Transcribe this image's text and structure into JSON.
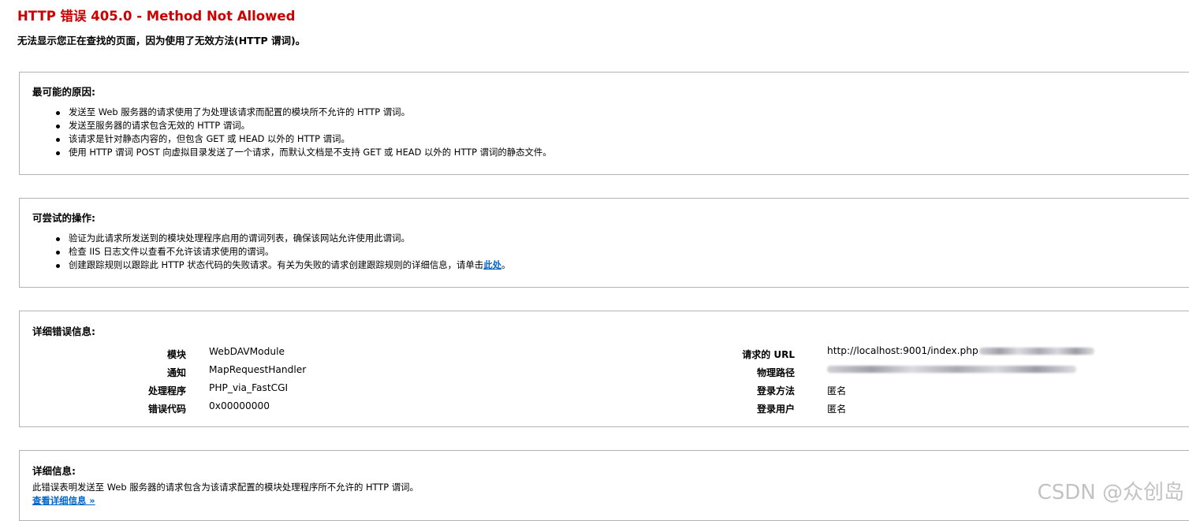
{
  "header": {
    "title": "HTTP 错误 405.0 - Method Not Allowed",
    "subtitle": "无法显示您正在查找的页面，因为使用了无效方法(HTTP 谓词)。"
  },
  "causes": {
    "title": "最可能的原因:",
    "items": [
      "发送至 Web 服务器的请求使用了为处理该请求而配置的模块所不允许的 HTTP 谓词。",
      "发送至服务器的请求包含无效的 HTTP 谓词。",
      "该请求是针对静态内容的，但包含 GET 或 HEAD 以外的 HTTP 谓词。",
      "使用 HTTP 谓词 POST 向虚拟目录发送了一个请求，而默认文档是不支持 GET 或 HEAD 以外的 HTTP 谓词的静态文件。"
    ]
  },
  "actions": {
    "title": "可尝试的操作:",
    "items": [
      "验证为此请求所发送到的模块处理程序启用的谓词列表，确保该网站允许使用此谓词。",
      "检查 IIS 日志文件以查看不允许该请求使用的谓词。"
    ],
    "last_item_prefix": "创建跟踪规则以跟踪此 HTTP 状态代码的失败请求。有关为失败的请求创建跟踪规则的详细信息，请单击",
    "last_item_link": "此处",
    "last_item_suffix": "。"
  },
  "error_info": {
    "title": "详细错误信息:",
    "left": [
      {
        "label": "模块",
        "value": "WebDAVModule"
      },
      {
        "label": "通知",
        "value": "MapRequestHandler"
      },
      {
        "label": "处理程序",
        "value": "PHP_via_FastCGI"
      },
      {
        "label": "错误代码",
        "value": "0x00000000"
      }
    ],
    "right": [
      {
        "label": "请求的 URL",
        "value": "http://localhost:9001/index.php"
      },
      {
        "label": "物理路径",
        "value": ""
      },
      {
        "label": "登录方法",
        "value": "匿名"
      },
      {
        "label": "登录用户",
        "value": "匿名"
      }
    ]
  },
  "details": {
    "title": "详细信息:",
    "text": "此错误表明发送至 Web 服务器的请求包含为该请求配置的模块处理程序所不允许的 HTTP 谓词。",
    "link": "查看详细信息 »"
  },
  "watermark": "CSDN @众创岛",
  "colors": {
    "title_red": "#cc0000",
    "link_blue": "#0066cc",
    "box_border": "#b3b3b3"
  }
}
